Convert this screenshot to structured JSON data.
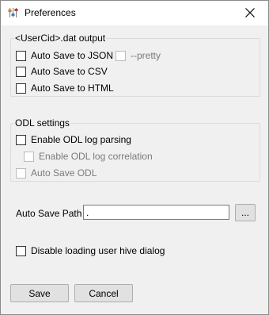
{
  "window": {
    "title": "Preferences"
  },
  "output_group": {
    "legend": "<UserCid>.dat output",
    "json": {
      "label": "Auto Save to JSON",
      "checked": false
    },
    "pretty": {
      "label": "--pretty",
      "checked": false,
      "enabled": false
    },
    "csv": {
      "label": "Auto Save to CSV",
      "checked": false
    },
    "html": {
      "label": "Auto Save to HTML",
      "checked": false
    }
  },
  "odl_group": {
    "legend": "ODL settings",
    "parsing": {
      "label": "Enable ODL log parsing",
      "checked": false
    },
    "correlation": {
      "label": "Enable ODL log correlation",
      "checked": false,
      "enabled": false
    },
    "auto_save": {
      "label": "Auto Save ODL",
      "checked": false,
      "enabled": false
    }
  },
  "path": {
    "label": "Auto Save Path",
    "value": ".",
    "browse_label": "..."
  },
  "hive": {
    "label": "Disable loading user hive dialog",
    "checked": false
  },
  "buttons": {
    "save": "Save",
    "cancel": "Cancel"
  },
  "icons": {
    "app": "preferences-sliders-icon",
    "close": "close-icon"
  }
}
